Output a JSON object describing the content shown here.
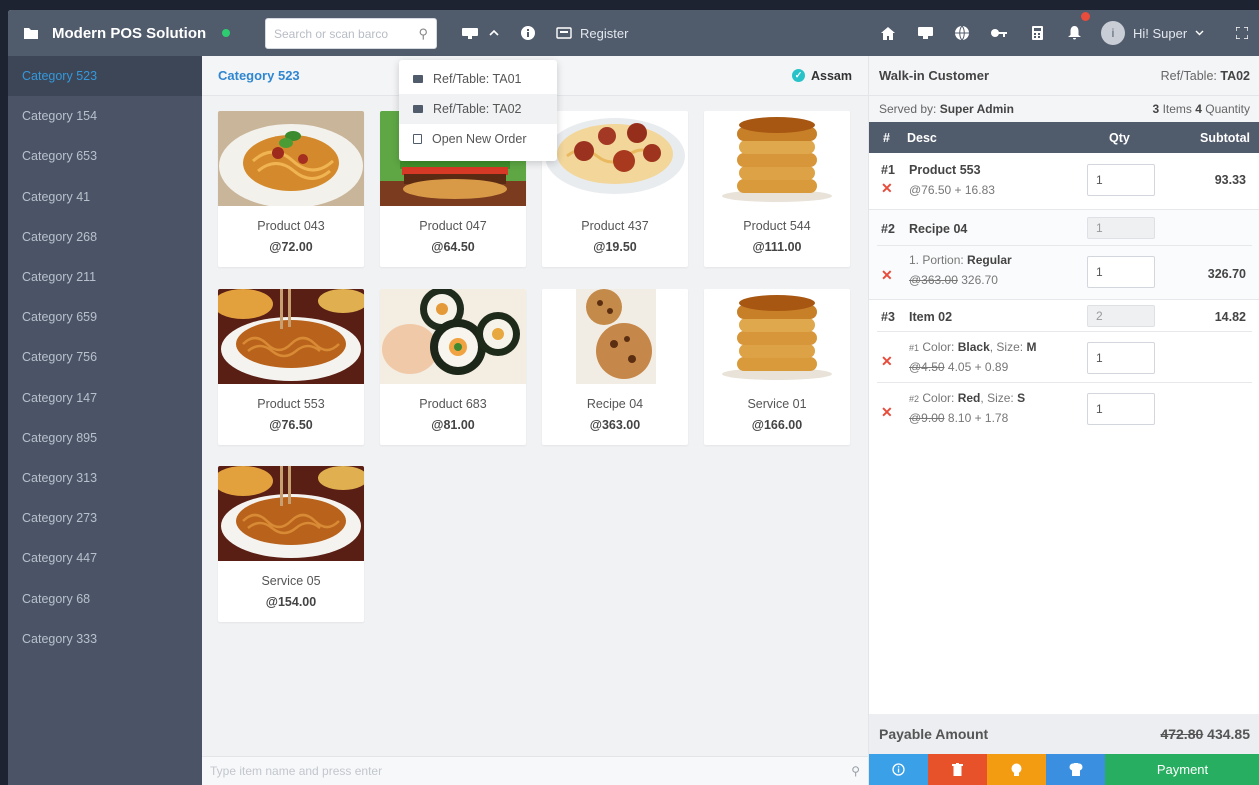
{
  "app": {
    "title": "Modern POS Solution"
  },
  "topbar": {
    "search_placeholder": "Search or scan barco",
    "register_label": "Register",
    "user_greeting": "Hi! Super",
    "avatar_initial": "i",
    "icons": [
      "folder-icon",
      "search-icon",
      "table-icon",
      "chevron-up-icon",
      "info-icon",
      "register-icon",
      "home-icon",
      "monitor-icon",
      "globe-icon",
      "key-icon",
      "calculator-icon",
      "bell-icon",
      "expand-icon"
    ]
  },
  "sidebar": {
    "categories": [
      "Category 523",
      "Category 154",
      "Category 653",
      "Category 41",
      "Category 268",
      "Category 211",
      "Category 659",
      "Category 756",
      "Category 147",
      "Category 895",
      "Category 313",
      "Category 273",
      "Category 447",
      "Category 68",
      "Category 333"
    ],
    "active_index": 0
  },
  "main": {
    "title": "Category 523",
    "location": "Assam",
    "bottom_placeholder": "Type item name and press enter",
    "products": [
      {
        "name": "Product 043",
        "price": "@72.00",
        "image": "spaghetti-basil"
      },
      {
        "name": "Product 047",
        "price": "@64.50",
        "image": "burger"
      },
      {
        "name": "Product 437",
        "price": "@19.50",
        "image": "spaghetti-meatballs"
      },
      {
        "name": "Product 544",
        "price": "@111.00",
        "image": "pancakes"
      },
      {
        "name": "Product 553",
        "price": "@76.50",
        "image": "noodles"
      },
      {
        "name": "Product 683",
        "price": "@81.00",
        "image": "sushi"
      },
      {
        "name": "Recipe 04",
        "price": "@363.00",
        "image": "cookies"
      },
      {
        "name": "Service 01",
        "price": "@166.00",
        "image": "pancakes"
      },
      {
        "name": "Service 05",
        "price": "@154.00",
        "image": "noodles"
      }
    ]
  },
  "dropdown": {
    "items": [
      "Ref/Table: TA01",
      "Ref/Table: TA02",
      "Open New Order"
    ],
    "selected_index": 1
  },
  "order": {
    "customer": "Walk-in Customer",
    "ref_label": "Ref/Table:",
    "ref_value": "TA02",
    "served_label": "Served by:",
    "served_value": "Super Admin",
    "items_count": "3",
    "items_label": "Items",
    "quantity_count": "4",
    "quantity_label": "Quantity",
    "columns": {
      "num": "#",
      "desc": "Desc",
      "qty": "Qty",
      "subtotal": "Subtotal"
    },
    "line1": {
      "num": "#1",
      "name": "Product 553",
      "price": "@76.50 + 16.83",
      "qty": "1",
      "subtotal": "93.33"
    },
    "line2": {
      "num": "#2",
      "name": "Recipe 04",
      "qty": "1",
      "sub_label": "1. Portion:",
      "sub_value": "Regular",
      "old_price": "@363.00",
      "new_price": "326.70",
      "sub_qty": "1",
      "subtotal": "326.70"
    },
    "line3": {
      "num": "#3",
      "name": "Item 02",
      "qty": "2",
      "subtotal": "14.82",
      "v1_num": "#1",
      "v1_color_label": "Color:",
      "v1_color": "Black",
      "v1_size_label": "Size:",
      "v1_size": "M",
      "v1_old": "@4.50",
      "v1_new": "4.05 + 0.89",
      "v1_qty": "1",
      "v2_num": "#2",
      "v2_color_label": "Color:",
      "v2_color": "Red",
      "v2_size_label": "Size:",
      "v2_size": "S",
      "v2_old": "@9.00",
      "v2_new": "8.10 + 1.78",
      "v2_qty": "1"
    },
    "payable_label": "Payable Amount",
    "payable_old": "472.80",
    "payable_new": "434.85",
    "payment_label": "Payment",
    "action_colors": {
      "info": "#3aa0e8",
      "delete": "#e8522a",
      "hold": "#f39c12",
      "view": "#3a8fe0",
      "payment": "#27ae60"
    }
  },
  "colors": {
    "topbar": "#505b6c",
    "sidebar": "#4a5466",
    "accent": "#2f86d1",
    "danger": "#e74c3c"
  }
}
